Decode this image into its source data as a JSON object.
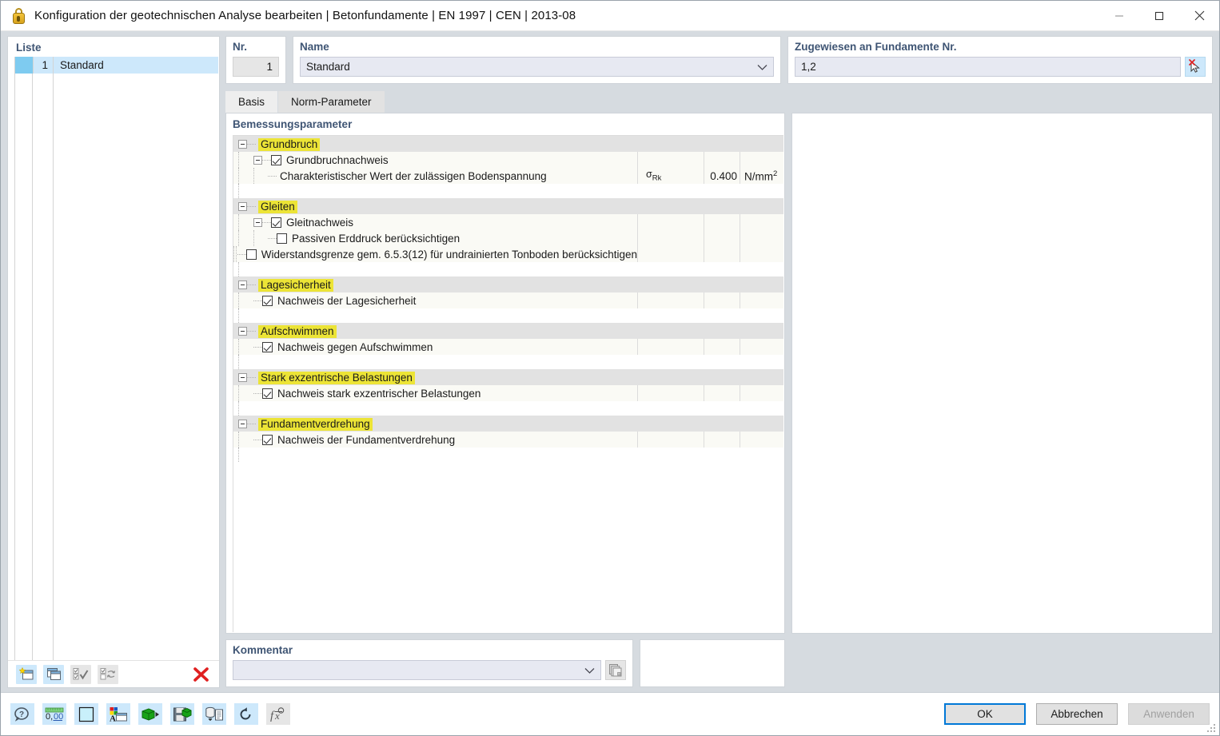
{
  "window": {
    "title": "Konfiguration der geotechnischen Analyse bearbeiten | Betonfundamente | EN 1997 | CEN | 2013-08",
    "icon": "lock-icon",
    "minimize": "minimize-icon",
    "maximize": "maximize-icon",
    "close": "close-icon"
  },
  "left": {
    "caption": "Liste",
    "rows": [
      {
        "num": "1",
        "name": "Standard",
        "color": "#7ecbf0"
      }
    ],
    "toolbar": [
      {
        "name": "new-configuration-button",
        "title": "Neu"
      },
      {
        "name": "copy-configuration-button",
        "title": "Kopieren"
      },
      {
        "name": "select-all-button",
        "title": "Alle auswählen"
      },
      {
        "name": "invert-selection-button",
        "title": "Auswahl umkehren"
      },
      {
        "name": "delete-configuration-button",
        "title": "Löschen"
      }
    ]
  },
  "header": {
    "nr_label": "Nr.",
    "nr_value": "1",
    "name_label": "Name",
    "name_value": "Standard",
    "assigned_label": "Zugewiesen an Fundamente Nr.",
    "assigned_value": "1,2",
    "pick_button": "select-objects-button"
  },
  "tabs": [
    {
      "label": "Basis",
      "active": true
    },
    {
      "label": "Norm-Parameter",
      "active": false
    }
  ],
  "tree": {
    "caption": "Bemessungsparameter",
    "columns": {
      "symbol": "",
      "value": "",
      "unit": ""
    },
    "groups": [
      {
        "title": "Grundbruch",
        "expanded": true,
        "rows": [
          {
            "type": "check-parent",
            "label": "Grundbruchnachweis",
            "checked": true,
            "expanded": true,
            "symbol": "",
            "value": "",
            "unit": ""
          },
          {
            "type": "value",
            "label": "Charakteristischer Wert der zulässigen Bodenspannung",
            "symbol": "σRk",
            "symbol_base": "σ",
            "symbol_sub": "Rk",
            "value": "0.400",
            "unit": "N/mm²",
            "unit_base": "N/mm",
            "unit_sup": "2"
          }
        ]
      },
      {
        "title": "Gleiten",
        "expanded": true,
        "rows": [
          {
            "type": "check-parent",
            "label": "Gleitnachweis",
            "checked": true,
            "expanded": true,
            "symbol": "",
            "value": "",
            "unit": ""
          },
          {
            "type": "check-child",
            "label": "Passiven Erddruck berücksichtigen",
            "checked": false,
            "symbol": "",
            "value": "",
            "unit": ""
          },
          {
            "type": "check-child",
            "label": "Widerstandsgrenze gem. 6.5.3(12) für undrainierten Tonboden berücksichtigen",
            "checked": false,
            "symbol": "",
            "value": "",
            "unit": ""
          }
        ]
      },
      {
        "title": "Lagesicherheit",
        "expanded": true,
        "rows": [
          {
            "type": "check-leaf",
            "label": "Nachweis der Lagesicherheit",
            "checked": true,
            "symbol": "",
            "value": "",
            "unit": ""
          }
        ]
      },
      {
        "title": "Aufschwimmen",
        "expanded": true,
        "rows": [
          {
            "type": "check-leaf",
            "label": "Nachweis gegen Aufschwimmen",
            "checked": true,
            "symbol": "",
            "value": "",
            "unit": ""
          }
        ]
      },
      {
        "title": "Stark exzentrische Belastungen",
        "expanded": true,
        "rows": [
          {
            "type": "check-leaf",
            "label": "Nachweis stark exzentrischer Belastungen",
            "checked": true,
            "symbol": "",
            "value": "",
            "unit": ""
          }
        ]
      },
      {
        "title": "Fundamentverdrehung",
        "expanded": true,
        "rows": [
          {
            "type": "check-leaf",
            "label": "Nachweis der Fundamentverdrehung",
            "checked": true,
            "symbol": "",
            "value": "",
            "unit": ""
          }
        ]
      }
    ]
  },
  "comment": {
    "label": "Kommentar",
    "value": "",
    "placeholder": "",
    "copy_button": "copy-comment-button"
  },
  "footer": {
    "tools": [
      {
        "name": "help-icon",
        "title": "Hilfe"
      },
      {
        "name": "units-decimal-places-icon",
        "title": "Einheiten und Dezimalstellen"
      },
      {
        "name": "color-swatch-icon",
        "title": "Farbe"
      },
      {
        "name": "display-properties-icon",
        "title": "Anzeigeeigenschaften"
      },
      {
        "name": "import-icon",
        "title": "Importieren"
      },
      {
        "name": "save-icon",
        "title": "Speichern"
      },
      {
        "name": "database-report-icon",
        "title": "Bericht"
      },
      {
        "name": "reset-icon",
        "title": "Zurücksetzen"
      },
      {
        "name": "formula-icon",
        "title": "Formel"
      }
    ],
    "buttons": {
      "ok": "OK",
      "cancel": "Abbrechen",
      "apply": "Anwenden"
    }
  },
  "colors": {
    "highlight_yellow": "#ece436",
    "accent_blue": "#0078d7",
    "list_selection": "#cde8fb",
    "label_blue": "#3f5574",
    "delete_red": "#e02020"
  }
}
